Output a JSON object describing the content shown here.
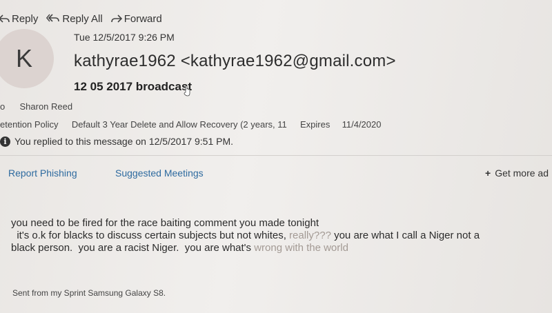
{
  "toolbar": {
    "reply_label": "Reply",
    "reply_all_label": "Reply All",
    "forward_label": "Forward"
  },
  "message": {
    "date": "Tue 12/5/2017 9:26 PM",
    "avatar_initial": "K",
    "sender": "kathyrae1962 <kathyrae1962@gmail.com>",
    "subject": "12 05 2017 broadcast",
    "to_prefix": "o",
    "to_name": "Sharon Reed",
    "retention_label": "etention Policy",
    "retention_value": "Default 3 Year Delete and Allow Recovery (2 years, 11",
    "expires_label": "Expires",
    "expires_value": "11/4/2020",
    "replied_notice": "You replied to this message on 12/5/2017 9:51 PM."
  },
  "actions": {
    "report_phishing": "Report Phishing",
    "suggested_meetings": "Suggested Meetings",
    "get_more_addins": "Get more ad"
  },
  "body": {
    "line1": "you need to be fired for the race baiting comment you made tonight",
    "line2_main": "  it's o.k for blacks to discuss certain subjects but not whites,",
    "line2_faded": " really???",
    "line2_end": " you are what I call a Niger not a",
    "line3_main": "black person.  you are a racist Niger.  you are what's",
    "line3_faded": " wrong with the world",
    "signature": "Sent from my Sprint Samsung Galaxy S8."
  },
  "colors": {
    "link": "#2d6a9f",
    "avatar_bg": "#dcd3d0",
    "background": "#eeebe8"
  }
}
